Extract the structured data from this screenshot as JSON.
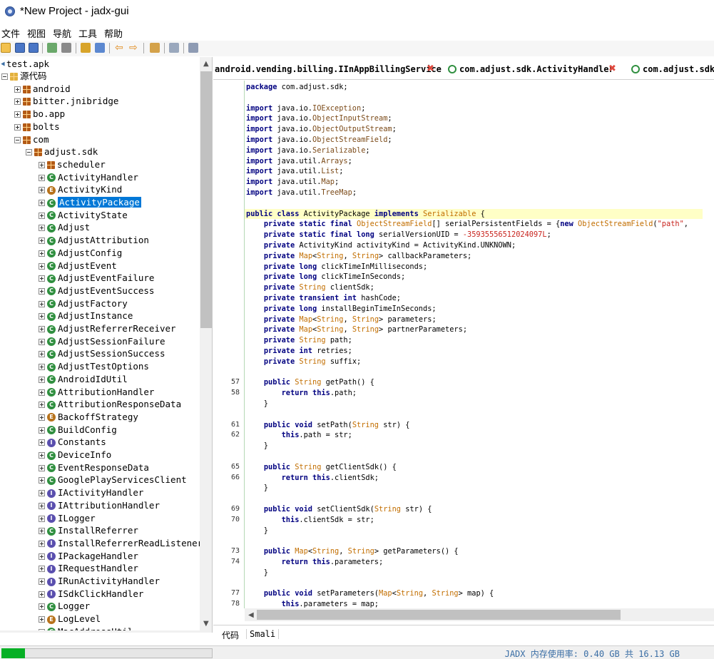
{
  "window": {
    "title": "*New Project - jadx-gui"
  },
  "menu": [
    "文件",
    "视图",
    "导航",
    "工具",
    "帮助"
  ],
  "toolbar_icons": [
    "open-icon",
    "save-icon",
    "save-all-icon",
    "sync-icon",
    "tree-icon",
    "search-icon",
    "find-icon",
    "back-icon",
    "forward-icon",
    "decompile-icon",
    "log-icon",
    "preferences-icon"
  ],
  "tree": {
    "root": "test.apk",
    "source_label": "源代码",
    "items": [
      {
        "label": "android",
        "kind": "pkg",
        "depth": 2
      },
      {
        "label": "bitter.jnibridge",
        "kind": "pkg",
        "depth": 2
      },
      {
        "label": "bo.app",
        "kind": "pkg",
        "depth": 2
      },
      {
        "label": "bolts",
        "kind": "pkg",
        "depth": 2
      },
      {
        "label": "com",
        "kind": "pkg",
        "depth": 2,
        "open": true
      },
      {
        "label": "adjust.sdk",
        "kind": "pkg",
        "depth": 3,
        "open": true
      },
      {
        "label": "scheduler",
        "kind": "pkg",
        "depth": 4
      },
      {
        "label": "ActivityHandler",
        "kind": "c",
        "depth": 4
      },
      {
        "label": "ActivityKind",
        "kind": "e",
        "depth": 4
      },
      {
        "label": "ActivityPackage",
        "kind": "c",
        "depth": 4,
        "selected": true
      },
      {
        "label": "ActivityState",
        "kind": "c",
        "depth": 4
      },
      {
        "label": "Adjust",
        "kind": "c",
        "depth": 4
      },
      {
        "label": "AdjustAttribution",
        "kind": "c",
        "depth": 4
      },
      {
        "label": "AdjustConfig",
        "kind": "c",
        "depth": 4
      },
      {
        "label": "AdjustEvent",
        "kind": "c",
        "depth": 4
      },
      {
        "label": "AdjustEventFailure",
        "kind": "c",
        "depth": 4
      },
      {
        "label": "AdjustEventSuccess",
        "kind": "c",
        "depth": 4
      },
      {
        "label": "AdjustFactory",
        "kind": "c",
        "depth": 4
      },
      {
        "label": "AdjustInstance",
        "kind": "c",
        "depth": 4
      },
      {
        "label": "AdjustReferrerReceiver",
        "kind": "c",
        "depth": 4
      },
      {
        "label": "AdjustSessionFailure",
        "kind": "c",
        "depth": 4
      },
      {
        "label": "AdjustSessionSuccess",
        "kind": "c",
        "depth": 4
      },
      {
        "label": "AdjustTestOptions",
        "kind": "c",
        "depth": 4
      },
      {
        "label": "AndroidIdUtil",
        "kind": "c",
        "depth": 4
      },
      {
        "label": "AttributionHandler",
        "kind": "c",
        "depth": 4
      },
      {
        "label": "AttributionResponseData",
        "kind": "c",
        "depth": 4
      },
      {
        "label": "BackoffStrategy",
        "kind": "e",
        "depth": 4
      },
      {
        "label": "BuildConfig",
        "kind": "c",
        "depth": 4
      },
      {
        "label": "Constants",
        "kind": "i",
        "depth": 4
      },
      {
        "label": "DeviceInfo",
        "kind": "c",
        "depth": 4
      },
      {
        "label": "EventResponseData",
        "kind": "c",
        "depth": 4
      },
      {
        "label": "GooglePlayServicesClient",
        "kind": "c",
        "depth": 4
      },
      {
        "label": "IActivityHandler",
        "kind": "i",
        "depth": 4
      },
      {
        "label": "IAttributionHandler",
        "kind": "i",
        "depth": 4
      },
      {
        "label": "ILogger",
        "kind": "i",
        "depth": 4
      },
      {
        "label": "InstallReferrer",
        "kind": "c",
        "depth": 4
      },
      {
        "label": "InstallReferrerReadListener",
        "kind": "i",
        "depth": 4
      },
      {
        "label": "IPackageHandler",
        "kind": "i",
        "depth": 4
      },
      {
        "label": "IRequestHandler",
        "kind": "i",
        "depth": 4
      },
      {
        "label": "IRunActivityHandler",
        "kind": "i",
        "depth": 4
      },
      {
        "label": "ISdkClickHandler",
        "kind": "i",
        "depth": 4
      },
      {
        "label": "Logger",
        "kind": "c",
        "depth": 4
      },
      {
        "label": "LogLevel",
        "kind": "e",
        "depth": 4
      },
      {
        "label": "MacAddressUtil",
        "kind": "c",
        "depth": 4
      }
    ]
  },
  "tabs": [
    {
      "label": "android.vending.billing.IInAppBillingService",
      "close": "✖"
    },
    {
      "label": "com.adjust.sdk.ActivityHandler",
      "close": "✖"
    },
    {
      "label": "com.adjust.sdk",
      "close": ""
    }
  ],
  "code_lines": [
    {
      "ln": "",
      "html": "<span class=\"kw\">package</span> com.adjust.sdk;"
    },
    {
      "ln": "",
      "html": ""
    },
    {
      "ln": "",
      "html": "<span class=\"kw\">import</span> java.io.<span class=\"im\">IOException</span>;"
    },
    {
      "ln": "",
      "html": "<span class=\"kw\">import</span> java.io.<span class=\"im\">ObjectInputStream</span>;"
    },
    {
      "ln": "",
      "html": "<span class=\"kw\">import</span> java.io.<span class=\"im\">ObjectOutputStream</span>;"
    },
    {
      "ln": "",
      "html": "<span class=\"kw\">import</span> java.io.<span class=\"im\">ObjectStreamField</span>;"
    },
    {
      "ln": "",
      "html": "<span class=\"kw\">import</span> java.io.<span class=\"im\">Serializable</span>;"
    },
    {
      "ln": "",
      "html": "<span class=\"kw\">import</span> java.util.<span class=\"im\">Arrays</span>;"
    },
    {
      "ln": "",
      "html": "<span class=\"kw\">import</span> java.util.<span class=\"im\">List</span>;"
    },
    {
      "ln": "",
      "html": "<span class=\"kw\">import</span> java.util.<span class=\"im\">Map</span>;"
    },
    {
      "ln": "",
      "html": "<span class=\"kw\">import</span> java.util.<span class=\"im\">TreeMap</span>;"
    },
    {
      "ln": "",
      "html": ""
    },
    {
      "ln": "",
      "hl": true,
      "html": "<span class=\"kw\">public class</span> ActivityPackage <span class=\"kw\">implements</span> <span class=\"ty\">Serializable</span> {"
    },
    {
      "ln": "",
      "html": "    <span class=\"kw\">private static final</span> <span class=\"ty\">ObjectStreamField</span>[] serialPersistentFields = {<span class=\"kw\">new</span> <span class=\"ty\">ObjectStreamField</span>(<span class=\"st\">\"path\"</span>,"
    },
    {
      "ln": "",
      "html": "    <span class=\"kw\">private static final long</span> serialVersionUID = <span class=\"st\">-35935556512024097L</span>;"
    },
    {
      "ln": "",
      "html": "    <span class=\"kw\">private</span> ActivityKind activityKind = ActivityKind.UNKNOWN;"
    },
    {
      "ln": "",
      "html": "    <span class=\"kw\">private</span> <span class=\"ty\">Map</span>&lt;<span class=\"ty\">String</span>, <span class=\"ty\">String</span>&gt; callbackParameters;"
    },
    {
      "ln": "",
      "html": "    <span class=\"kw\">private long</span> clickTimeInMilliseconds;"
    },
    {
      "ln": "",
      "html": "    <span class=\"kw\">private long</span> clickTimeInSeconds;"
    },
    {
      "ln": "",
      "html": "    <span class=\"kw\">private</span> <span class=\"ty\">String</span> clientSdk;"
    },
    {
      "ln": "",
      "html": "    <span class=\"kw\">private transient int</span> hashCode;"
    },
    {
      "ln": "",
      "html": "    <span class=\"kw\">private long</span> installBeginTimeInSeconds;"
    },
    {
      "ln": "",
      "html": "    <span class=\"kw\">private</span> <span class=\"ty\">Map</span>&lt;<span class=\"ty\">String</span>, <span class=\"ty\">String</span>&gt; parameters;"
    },
    {
      "ln": "",
      "html": "    <span class=\"kw\">private</span> <span class=\"ty\">Map</span>&lt;<span class=\"ty\">String</span>, <span class=\"ty\">String</span>&gt; partnerParameters;"
    },
    {
      "ln": "",
      "html": "    <span class=\"kw\">private</span> <span class=\"ty\">String</span> path;"
    },
    {
      "ln": "",
      "html": "    <span class=\"kw\">private int</span> retries;"
    },
    {
      "ln": "",
      "html": "    <span class=\"kw\">private</span> <span class=\"ty\">String</span> suffix;"
    },
    {
      "ln": "",
      "html": ""
    },
    {
      "ln": "57",
      "html": "    <span class=\"kw\">public</span> <span class=\"ty\">String</span> getPath() {"
    },
    {
      "ln": "58",
      "html": "        <span class=\"kw\">return this</span>.path;"
    },
    {
      "ln": "",
      "html": "    }"
    },
    {
      "ln": "",
      "html": ""
    },
    {
      "ln": "61",
      "html": "    <span class=\"kw\">public void</span> setPath(<span class=\"ty\">String</span> str) {"
    },
    {
      "ln": "62",
      "html": "        <span class=\"kw\">this</span>.path = str;"
    },
    {
      "ln": "",
      "html": "    }"
    },
    {
      "ln": "",
      "html": ""
    },
    {
      "ln": "65",
      "html": "    <span class=\"kw\">public</span> <span class=\"ty\">String</span> getClientSdk() {"
    },
    {
      "ln": "66",
      "html": "        <span class=\"kw\">return this</span>.clientSdk;"
    },
    {
      "ln": "",
      "html": "    }"
    },
    {
      "ln": "",
      "html": ""
    },
    {
      "ln": "69",
      "html": "    <span class=\"kw\">public void</span> setClientSdk(<span class=\"ty\">String</span> str) {"
    },
    {
      "ln": "70",
      "html": "        <span class=\"kw\">this</span>.clientSdk = str;"
    },
    {
      "ln": "",
      "html": "    }"
    },
    {
      "ln": "",
      "html": ""
    },
    {
      "ln": "73",
      "html": "    <span class=\"kw\">public</span> <span class=\"ty\">Map</span>&lt;<span class=\"ty\">String</span>, <span class=\"ty\">String</span>&gt; getParameters() {"
    },
    {
      "ln": "74",
      "html": "        <span class=\"kw\">return this</span>.parameters;"
    },
    {
      "ln": "",
      "html": "    }"
    },
    {
      "ln": "",
      "html": ""
    },
    {
      "ln": "77",
      "html": "    <span class=\"kw\">public void</span> setParameters(<span class=\"ty\">Map</span>&lt;<span class=\"ty\">String</span>, <span class=\"ty\">String</span>&gt; map) {"
    },
    {
      "ln": "78",
      "html": "        <span class=\"kw\">this</span>.parameters = map;"
    }
  ],
  "bottom_tabs": {
    "code": "代码",
    "smali": "Smali"
  },
  "status": {
    "memory": "JADX 内存使用率: 0.40 GB 共 16.13 GB",
    "progress": 0.11
  },
  "colors": {
    "selection": "#0078d7",
    "class_icon": "#2f8f3f",
    "progress": "#06b025"
  }
}
